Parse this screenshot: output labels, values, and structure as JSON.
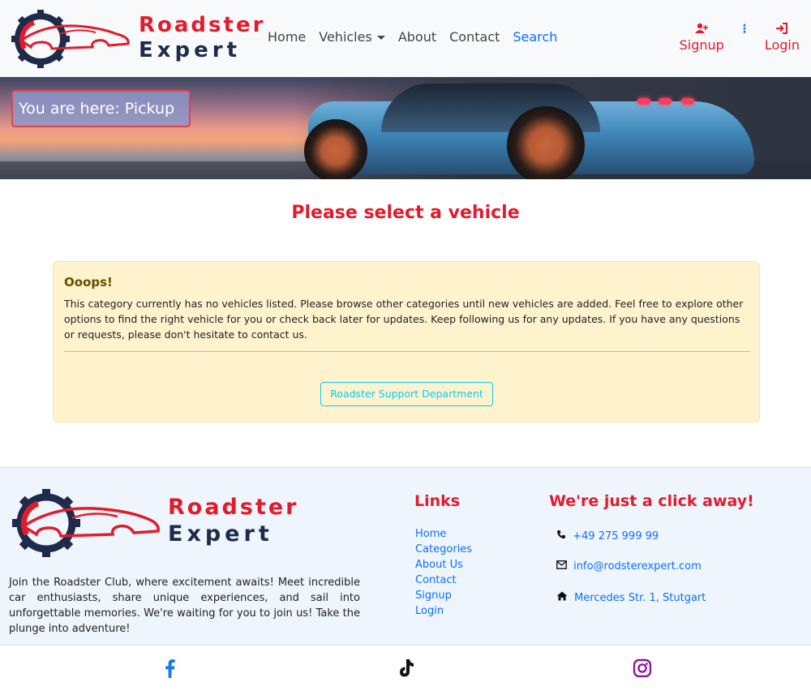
{
  "brand": {
    "line1": "Roadster",
    "line2": "Expert"
  },
  "nav": {
    "items": [
      {
        "label": "Home"
      },
      {
        "label": "Vehicles"
      },
      {
        "label": "About"
      },
      {
        "label": "Contact"
      },
      {
        "label": "Search"
      }
    ],
    "signup_label": "Signup",
    "login_label": "Login"
  },
  "hero": {
    "breadcrumb": "You are here: Pickup"
  },
  "main": {
    "title": "Please select a vehicle",
    "alert": {
      "heading": "Ooops!",
      "body": "This category currently has no vehicles listed. Please browse other categories until new vehicles are added. Feel free to explore other options to find the right vehicle for you or check back later for updates. Keep following us for any updates. If you have any questions or requests, please don't hesitate to contact us.",
      "button_label": "Roadster Support Department"
    }
  },
  "footer": {
    "description": "Join the Roadster Club, where excitement awaits! Meet incredible car enthusiasts, share unique experiences, and sail into unforgettable memories. We're waiting for you to join us! Take the plunge into adventure!",
    "links_title": "Links",
    "links": [
      "Home",
      "Categories",
      "About Us",
      "Contact",
      "Signup",
      "Login"
    ],
    "contact_title": "We're just a click away!",
    "phone": "+49 275 999 99",
    "email": "info@rodsterexpert.com",
    "address": "Mercedes Str. 1, Stutgart"
  },
  "social": [
    "facebook-icon",
    "tiktok-icon",
    "instagram-icon"
  ],
  "colors": {
    "brand_red": "#e21b2c",
    "link_blue": "#0d6efd",
    "alert_bg": "#fff3cd",
    "footer_bg": "#eef5fd"
  }
}
